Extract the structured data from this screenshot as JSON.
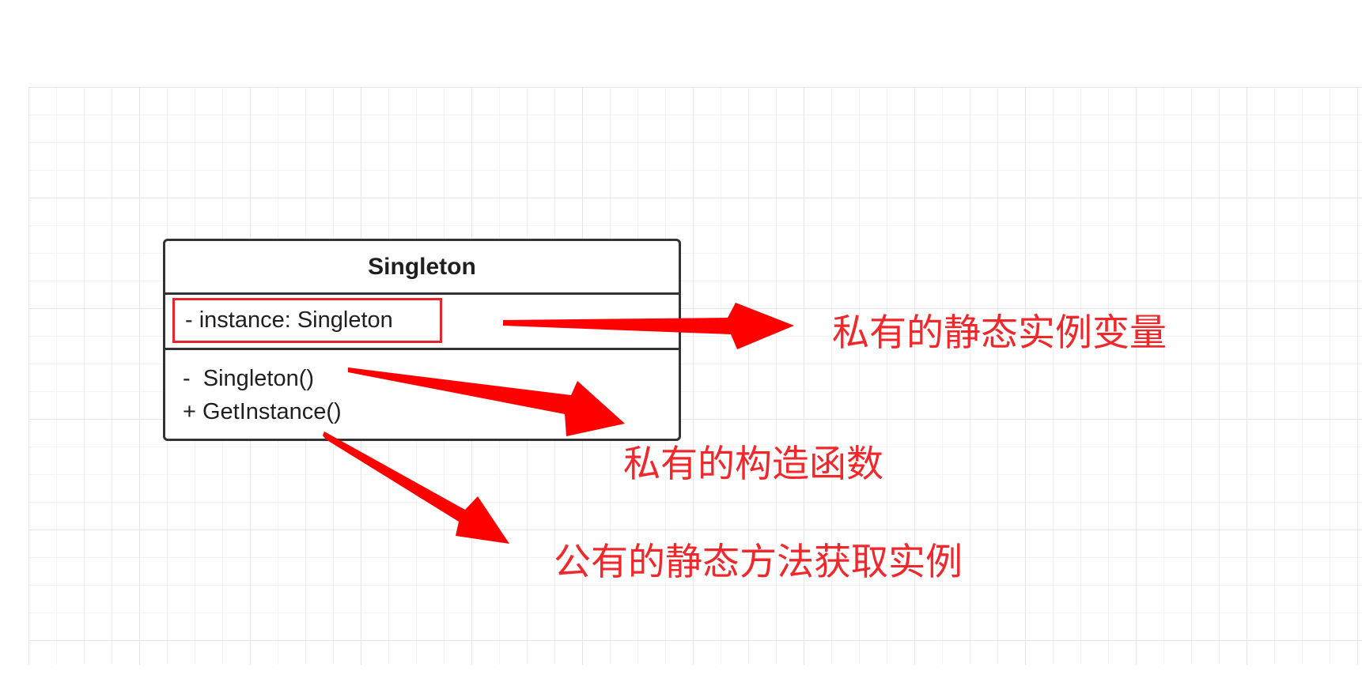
{
  "class_diagram": {
    "class_name": "Singleton",
    "attribute": "- instance: Singleton",
    "methods": [
      "-  Singleton()",
      "+ GetInstance()"
    ]
  },
  "annotations": {
    "attribute_note": "私有的静态实例变量",
    "constructor_note": "私有的构造函数",
    "method_note": "公有的静态方法获取实例"
  },
  "colors": {
    "annotation_red": "#f0282c",
    "highlight_border": "#e8242c",
    "grid_line": "#e6e6e6"
  }
}
